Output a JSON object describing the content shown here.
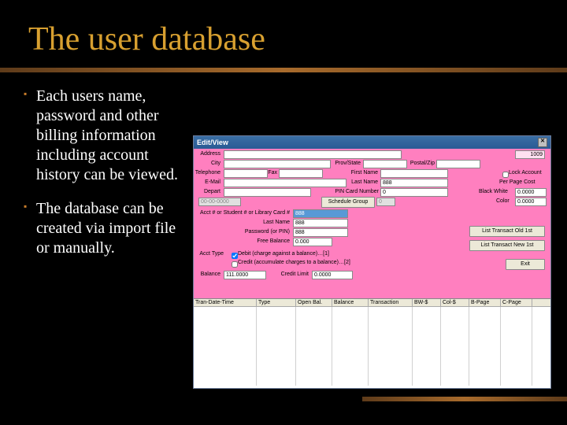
{
  "slide": {
    "title": "The user database",
    "bullet1": "Each users name, password and other billing information including account history can be viewed.",
    "bullet2": "The database can be created via import file or manually."
  },
  "app": {
    "window_title": "Edit/View",
    "labels": {
      "address": "Address",
      "city": "City",
      "prov": "Prov/State",
      "postal": "Postal/Zip",
      "telephone": "Telephone",
      "fax": "Fax",
      "first_name": "First Name",
      "lock_account": "Lock Account",
      "email": "E-Mail",
      "last_name": "Last Name",
      "per_page_cost": "Per Page Cost",
      "depart": "Depart",
      "pin_card": "PIN Card Number",
      "blackwhite": "Black White",
      "schedule_group": "Schedule Group",
      "color": "Color",
      "acct_or_student": "Acct # or Student # or Library Card #",
      "last_name2": "Last Name",
      "password": "Password (or PIN)",
      "free_balance": "Free Balance",
      "acct_type": "Acct Type",
      "radio_debit": "Debit (charge against a balance)…[1]",
      "radio_credit": "Credit (accumulate charges to a balance)…[2]",
      "balance": "Balance",
      "credit_limit": "Credit Limit"
    },
    "values": {
      "id_badge": "1009",
      "date_disabled": "00-00-0000",
      "sg_disabled": "0",
      "pin_card": "0",
      "bw_rate": "0.0000",
      "color_rate": "0.0000",
      "acct_num": "888",
      "last_name_top": "888",
      "last_name_form": "888",
      "password": "888",
      "free_balance": "0.000",
      "balance": "111.0000",
      "credit_limit": "0.0000"
    },
    "buttons": {
      "list_old": "List Transact Old 1st",
      "list_new": "List Transact New 1st",
      "exit": "Exit"
    },
    "grid_cols": [
      "Tran-Date-Time",
      "Type",
      "Open Bal.",
      "Balance",
      "Transaction",
      "BW-$",
      "Col-$",
      "B-Page",
      "C-Page"
    ]
  }
}
